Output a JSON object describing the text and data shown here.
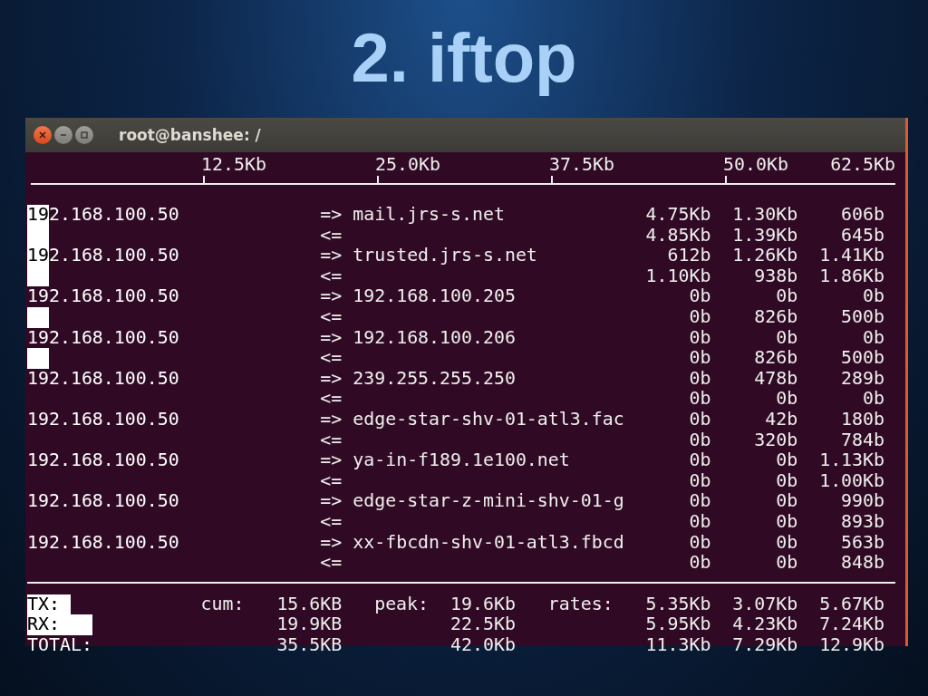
{
  "slide_title": "2. iftop",
  "window": {
    "title": "root@banshee: /"
  },
  "scale": [
    "12.5Kb",
    "25.0Kb",
    "37.5Kb",
    "50.0Kb",
    "62.5Kb"
  ],
  "flows": [
    {
      "host": "192.168.100.50",
      "dest": "mail.jrs-s.net",
      "out": {
        "arrow": "=>",
        "rates": [
          "4.75Kb",
          "1.30Kb",
          "606b"
        ],
        "level": 0.025
      },
      "in": {
        "arrow": "<=",
        "rates": [
          "4.85Kb",
          "1.39Kb",
          "645b"
        ],
        "level": 0.025
      }
    },
    {
      "host": "192.168.100.50",
      "dest": "trusted.jrs-s.net",
      "out": {
        "arrow": "=>",
        "rates": [
          "612b",
          "1.26Kb",
          "1.41Kb"
        ],
        "level": 0.025
      },
      "in": {
        "arrow": "<=",
        "rates": [
          "1.10Kb",
          "938b",
          "1.86Kb"
        ],
        "level": 0.025
      }
    },
    {
      "host": "192.168.100.50",
      "dest": "192.168.100.205",
      "out": {
        "arrow": "=>",
        "rates": [
          "0b",
          "0b",
          "0b"
        ]
      },
      "in": {
        "arrow": "<=",
        "rates": [
          "0b",
          "826b",
          "500b"
        ],
        "level": 0.025
      }
    },
    {
      "host": "192.168.100.50",
      "dest": "192.168.100.206",
      "out": {
        "arrow": "=>",
        "rates": [
          "0b",
          "0b",
          "0b"
        ]
      },
      "in": {
        "arrow": "<=",
        "rates": [
          "0b",
          "826b",
          "500b"
        ],
        "level": 0.025
      }
    },
    {
      "host": "192.168.100.50",
      "dest": "239.255.255.250",
      "out": {
        "arrow": "=>",
        "rates": [
          "0b",
          "478b",
          "289b"
        ]
      },
      "in": {
        "arrow": "<=",
        "rates": [
          "0b",
          "0b",
          "0b"
        ]
      }
    },
    {
      "host": "192.168.100.50",
      "dest": "edge-star-shv-01-atl3.fac",
      "out": {
        "arrow": "=>",
        "rates": [
          "0b",
          "42b",
          "180b"
        ]
      },
      "in": {
        "arrow": "<=",
        "rates": [
          "0b",
          "320b",
          "784b"
        ]
      }
    },
    {
      "host": "192.168.100.50",
      "dest": "ya-in-f189.1e100.net",
      "out": {
        "arrow": "=>",
        "rates": [
          "0b",
          "0b",
          "1.13Kb"
        ]
      },
      "in": {
        "arrow": "<=",
        "rates": [
          "0b",
          "0b",
          "1.00Kb"
        ]
      }
    },
    {
      "host": "192.168.100.50",
      "dest": "edge-star-z-mini-shv-01-g",
      "out": {
        "arrow": "=>",
        "rates": [
          "0b",
          "0b",
          "990b"
        ]
      },
      "in": {
        "arrow": "<=",
        "rates": [
          "0b",
          "0b",
          "893b"
        ]
      }
    },
    {
      "host": "192.168.100.50",
      "dest": "xx-fbcdn-shv-01-atl3.fbcd",
      "out": {
        "arrow": "=>",
        "rates": [
          "0b",
          "0b",
          "563b"
        ]
      },
      "in": {
        "arrow": "<=",
        "rates": [
          "0b",
          "0b",
          "848b"
        ]
      }
    }
  ],
  "totals": [
    {
      "label": "TX:",
      "cum_label": "cum:",
      "cum": "15.6KB",
      "peak_label": "peak:",
      "peak": "19.6Kb",
      "rates_label": "rates:",
      "rates": [
        "5.35Kb",
        "3.07Kb",
        "5.67Kb"
      ],
      "level": 0.05
    },
    {
      "label": "RX:",
      "cum": "19.9KB",
      "peak": "22.5Kb",
      "rates": [
        "5.95Kb",
        "4.23Kb",
        "7.24Kb"
      ],
      "level": 0.075
    },
    {
      "label": "TOTAL:",
      "cum": "35.5KB",
      "peak": "42.0Kb",
      "rates": [
        "11.3Kb",
        "7.29Kb",
        "12.9Kb"
      ]
    }
  ]
}
